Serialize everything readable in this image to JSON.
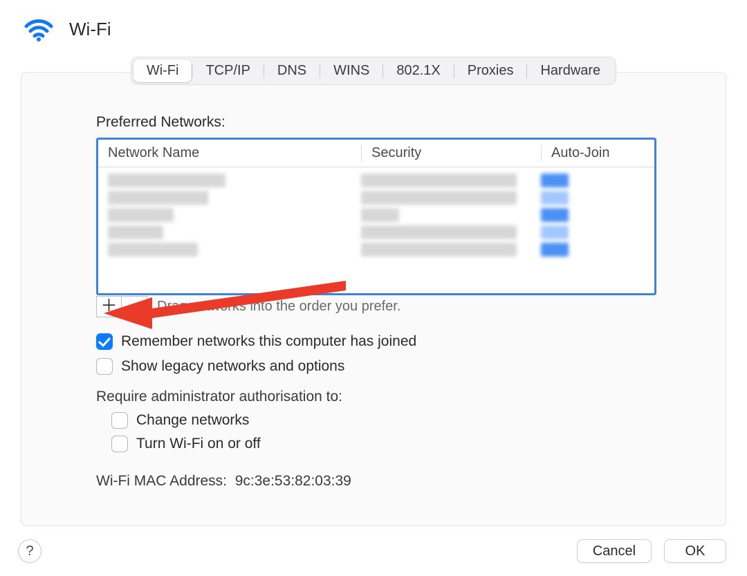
{
  "header": {
    "title": "Wi-Fi"
  },
  "tabs": [
    "Wi-Fi",
    "TCP/IP",
    "DNS",
    "WINS",
    "802.1X",
    "Proxies",
    "Hardware"
  ],
  "active_tab_index": 0,
  "preferred": {
    "label": "Preferred Networks:",
    "columns": {
      "name": "Network Name",
      "security": "Security",
      "autojoin": "Auto-Join"
    },
    "hint": "Drag networks into the order you prefer.",
    "add_symbol": "＋",
    "remove_symbol": "−"
  },
  "checks": {
    "remember": {
      "label": "Remember networks this computer has joined",
      "checked": true
    },
    "legacy": {
      "label": "Show legacy networks and options",
      "checked": false
    },
    "admin_label": "Require administrator authorisation to:",
    "change_networks": {
      "label": "Change networks",
      "checked": false
    },
    "wifi_toggle": {
      "label": "Turn Wi-Fi on or off",
      "checked": false
    }
  },
  "mac": {
    "label": "Wi-Fi MAC Address:",
    "value": "9c:3e:53:82:03:39"
  },
  "footer": {
    "help": "?",
    "cancel": "Cancel",
    "ok": "OK"
  }
}
